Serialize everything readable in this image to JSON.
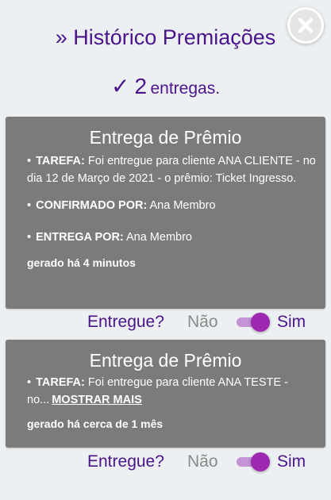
{
  "header": {
    "title": "» Histórico Premiações",
    "count_check": "✓",
    "count_number": "2",
    "count_label": "entregas."
  },
  "close_icon": "close-icon",
  "colors": {
    "accent": "#4a148c",
    "card_bg": "#7b7b7b",
    "switch_on": "#9c27b0",
    "page_bg": "#edf0f2"
  },
  "cards": [
    {
      "title": "Entrega de Prêmio",
      "bullet": "•",
      "tarefa_label": "TAREFA:",
      "tarefa_text": " Foi entregue para cliente ANA CLIENTE - no dia 12 de Março de 2021 - o prêmio: Ticket Ingresso.",
      "confirmado_label": "CONFIRMADO POR:",
      "confirmado_value": " Ana Membro",
      "entrega_label": "ENTREGA POR:",
      "entrega_value": " Ana Membro",
      "generated": "gerado há 4 minutos",
      "toggle": {
        "label": "Entregue?",
        "off": "Não",
        "on": "Sim",
        "checked": true
      }
    },
    {
      "title": "Entrega de Prêmio",
      "bullet": "•",
      "tarefa_label": "TAREFA:",
      "tarefa_text": " Foi entregue para cliente ANA TESTE - no...",
      "more_link": "MOSTRAR MAIS",
      "generated": "gerado há cerca de 1 mês",
      "toggle": {
        "label": "Entregue?",
        "off": "Não",
        "on": "Sim",
        "checked": true
      }
    }
  ]
}
